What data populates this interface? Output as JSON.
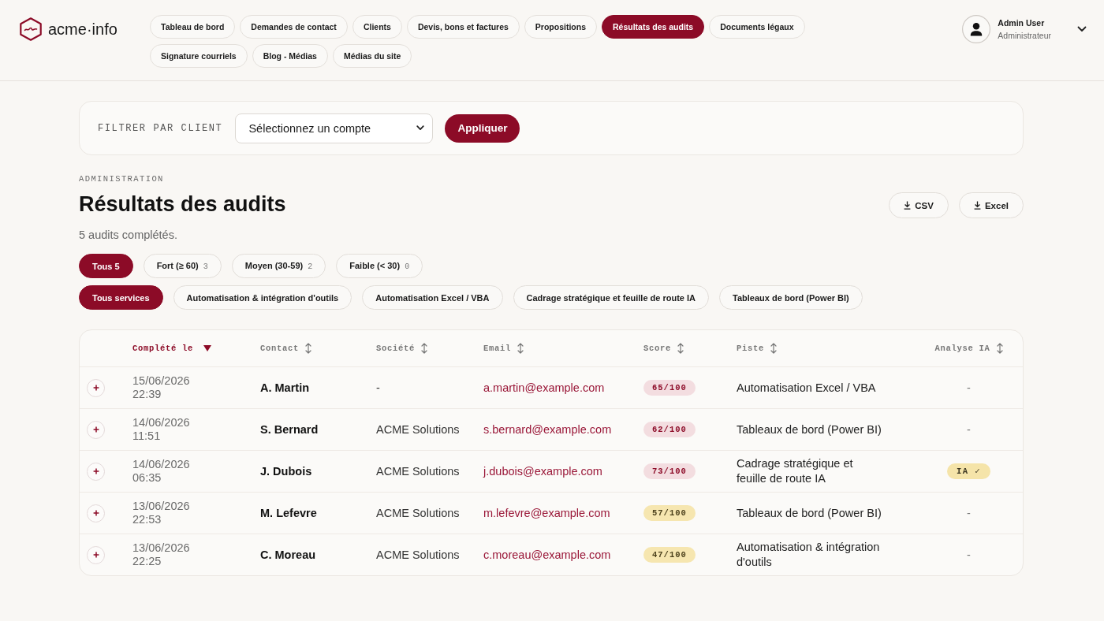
{
  "brand": {
    "name": "acme·info"
  },
  "nav": [
    {
      "label": "Tableau de bord",
      "selected": false
    },
    {
      "label": "Demandes de contact",
      "selected": false
    },
    {
      "label": "Clients",
      "selected": false
    },
    {
      "label": "Devis, bons et factures",
      "selected": false
    },
    {
      "label": "Propositions",
      "selected": false
    },
    {
      "label": "Résultats des audits",
      "selected": true
    },
    {
      "label": "Documents légaux",
      "selected": false
    },
    {
      "label": "Signature courriels",
      "selected": false
    },
    {
      "label": "Blog - Médias",
      "selected": false
    },
    {
      "label": "Médias du site",
      "selected": false
    }
  ],
  "user": {
    "name": "Admin User",
    "role": "Administrateur"
  },
  "client_filter": {
    "label": "FILTRER PAR CLIENT",
    "select": {
      "value": "Sélectionnez un compte"
    },
    "apply_button": "Appliquer"
  },
  "page": {
    "eyebrow": "ADMINISTRATION",
    "title": "Résultats des audits",
    "subtitle": "5 audits complétés.",
    "export_buttons": [
      "CSV",
      "Excel"
    ]
  },
  "score_filters": [
    {
      "label": "Tous",
      "count": "5",
      "selected": true
    },
    {
      "label": "Fort (≥ 60)",
      "count": "3",
      "selected": false
    },
    {
      "label": "Moyen (30-59)",
      "count": "2",
      "selected": false
    },
    {
      "label": "Faible (< 30)",
      "count": "0",
      "selected": false
    }
  ],
  "service_filters": [
    {
      "label": "Tous services",
      "selected": true
    },
    {
      "label": "Automatisation & intégration d'outils",
      "selected": false
    },
    {
      "label": "Automatisation Excel / VBA",
      "selected": false
    },
    {
      "label": "Cadrage stratégique et feuille de route IA",
      "selected": false
    },
    {
      "label": "Tableaux de bord (Power BI)",
      "selected": false
    }
  ],
  "table": {
    "columns": [
      {
        "label": "Complété le",
        "sorted": true
      },
      {
        "label": "Contact",
        "sorted": false
      },
      {
        "label": "Société",
        "sorted": false
      },
      {
        "label": "Email",
        "sorted": false
      },
      {
        "label": "Score",
        "sorted": false
      },
      {
        "label": "Piste",
        "sorted": false
      },
      {
        "label": "Analyse IA",
        "sorted": false
      }
    ],
    "rows": [
      {
        "expanded": false,
        "completed": "15/06/2026 22:39",
        "contact": "A. Martin",
        "company": "-",
        "email": "a.martin@example.com",
        "score": "65/100",
        "score_strong": true,
        "track": "Automatisation Excel / VBA",
        "ai_done": false,
        "ai_analysis": "-"
      },
      {
        "expanded": false,
        "completed": "14/06/2026 11:51",
        "contact": "S. Bernard",
        "company": "ACME Solutions",
        "email": "s.bernard@example.com",
        "score": "62/100",
        "score_strong": true,
        "track": "Tableaux de bord (Power BI)",
        "ai_done": false,
        "ai_analysis": "-"
      },
      {
        "expanded": false,
        "completed": "14/06/2026 06:35",
        "contact": "J. Dubois",
        "company": "ACME Solutions",
        "email": "j.dubois@example.com",
        "score": "73/100",
        "score_strong": true,
        "track": "Cadrage stratégique et feuille de route IA",
        "ai_done": true,
        "ai_analysis": "IA ✓"
      },
      {
        "expanded": false,
        "completed": "13/06/2026 22:53",
        "contact": "M. Lefevre",
        "company": "ACME Solutions",
        "email": "m.lefevre@example.com",
        "score": "57/100",
        "score_strong": false,
        "track": "Tableaux de bord (Power BI)",
        "ai_done": false,
        "ai_analysis": "-"
      },
      {
        "expanded": false,
        "completed": "13/06/2026 22:25",
        "contact": "C. Moreau",
        "company": "ACME Solutions",
        "email": "c.moreau@example.com",
        "score": "47/100",
        "score_strong": false,
        "track": "Automatisation & intégration d'outils",
        "ai_done": false,
        "ai_analysis": "-"
      }
    ]
  }
}
